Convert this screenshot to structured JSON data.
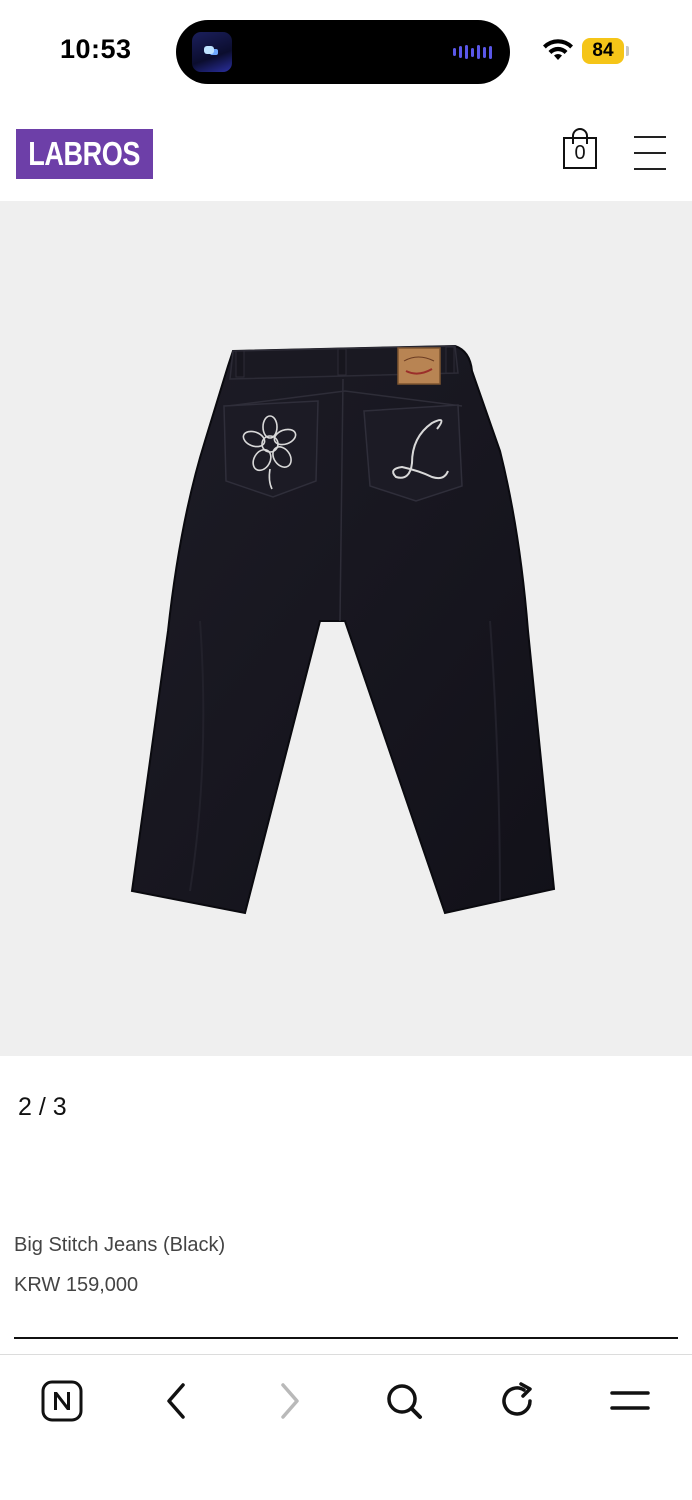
{
  "status_bar": {
    "time": "10:53",
    "battery": "84"
  },
  "header": {
    "logo_text": "LABROS",
    "cart_count": "0"
  },
  "product": {
    "pager": "2 / 3",
    "name": "Big Stitch Jeans (Black)",
    "price": "KRW 159,000"
  },
  "colors": {
    "brand": "#6d3fa8",
    "image_bg": "#efefef",
    "battery": "#f5c518"
  },
  "toolbar": {
    "items": [
      "naver-home-icon",
      "back-icon",
      "forward-icon",
      "search-icon",
      "refresh-icon",
      "menu-icon"
    ]
  }
}
